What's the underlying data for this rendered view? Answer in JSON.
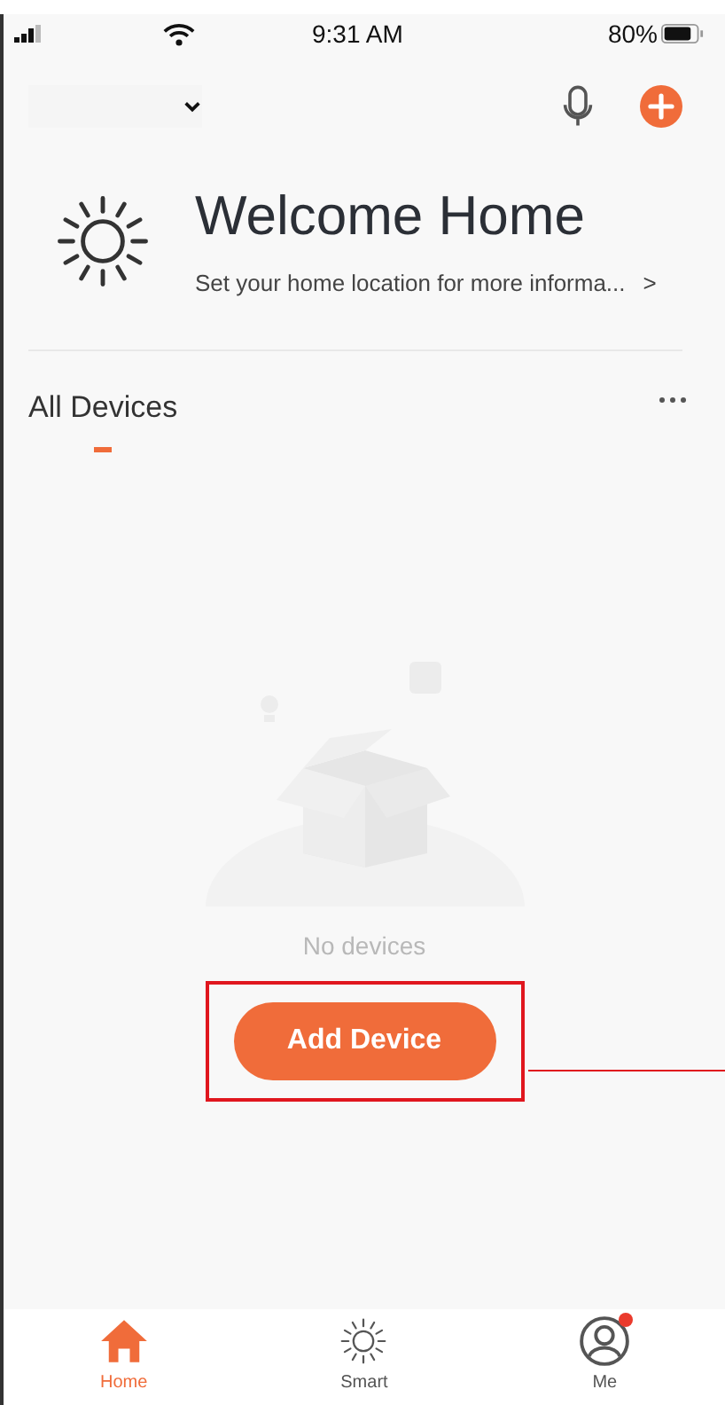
{
  "status_bar": {
    "time": "9:31 AM",
    "battery": "80%"
  },
  "welcome": {
    "title": "Welcome Home",
    "subtitle": "Set your home location for more informa...",
    "chevron": ">"
  },
  "section": {
    "title": "All Devices",
    "selected": true
  },
  "empty_state": {
    "message": "No devices"
  },
  "primary_button": {
    "label": "Add Device"
  },
  "tab_bar": [
    {
      "label": "Home",
      "kind": "home",
      "selected": true
    },
    {
      "label": "Smart",
      "kind": "smart",
      "selected": false
    },
    {
      "label": "Me",
      "kind": "profile",
      "selected": false,
      "badge": true
    }
  ]
}
